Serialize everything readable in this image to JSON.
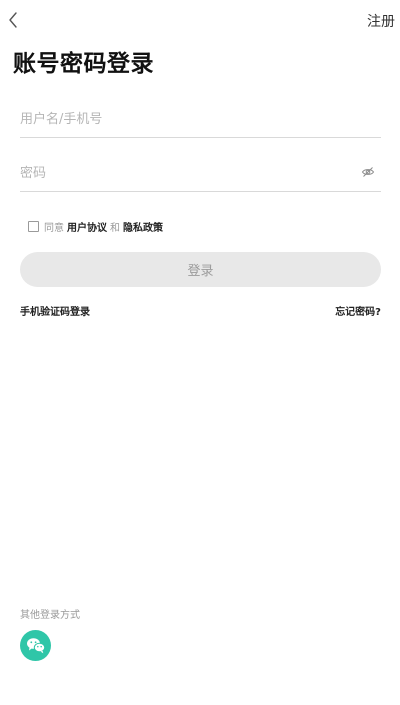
{
  "header": {
    "back_icon": "chevron-left-icon",
    "register_label": "注册"
  },
  "title": "账号密码登录",
  "form": {
    "username": {
      "value": "",
      "placeholder": "用户名/手机号"
    },
    "password": {
      "value": "",
      "placeholder": "密码",
      "toggle_icon": "eye-off-icon"
    }
  },
  "agreement": {
    "checked": false,
    "prefix": "同意",
    "user_agreement": "用户协议",
    "and": "和",
    "privacy_policy": "隐私政策"
  },
  "login_button_label": "登录",
  "links": {
    "sms_login": "手机验证码登录",
    "forgot_password": "忘记密码?"
  },
  "other_login": {
    "label": "其他登录方式",
    "wechat_icon": "wechat-icon",
    "wechat_color": "#2fc6a8"
  },
  "colors": {
    "button_disabled_bg": "#e8e8e8",
    "button_disabled_text": "#9b9b9b",
    "divider": "#d9d9d9"
  }
}
